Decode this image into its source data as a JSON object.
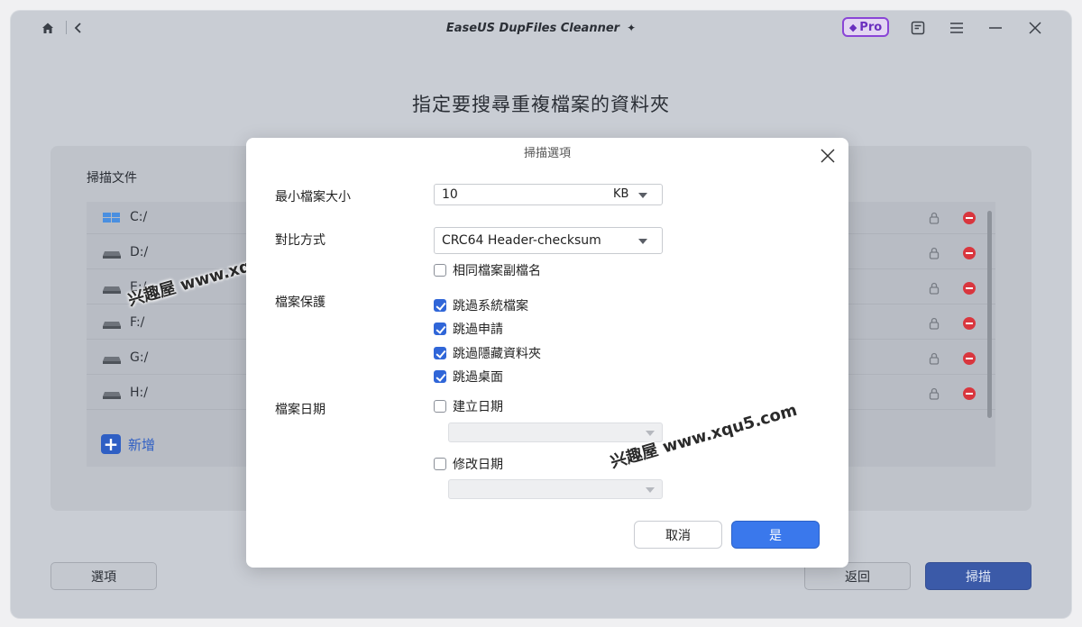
{
  "app": {
    "title": "EaseUS DupFiles Cleanner",
    "pro_label": "Pro"
  },
  "page": {
    "title": "指定要搜尋重複檔案的資料夾"
  },
  "scan_panel": {
    "label": "掃描文件",
    "drives": [
      {
        "label": "C:/"
      },
      {
        "label": "D:/"
      },
      {
        "label": "E:/"
      },
      {
        "label": "F:/"
      },
      {
        "label": "G:/"
      },
      {
        "label": "H:/"
      }
    ],
    "add_label": "新增"
  },
  "footer": {
    "options_label": "選項",
    "back_label": "返回",
    "scan_label": "掃描"
  },
  "watermark": {
    "text1": "兴趣屋 www.xqu5.com",
    "text2": "兴趣屋 www.xqu5.com"
  },
  "modal": {
    "title": "掃描選項",
    "min_size": {
      "label": "最小檔案大小",
      "value": "10",
      "unit": "KB"
    },
    "compare": {
      "label": "對比方式",
      "value": "CRC64 Header-checksum",
      "same_ext_label": "相同檔案副檔名",
      "same_ext_checked": false
    },
    "protection": {
      "label": "檔案保護",
      "options": [
        {
          "label": "跳過系統檔案",
          "checked": true
        },
        {
          "label": "跳過申請",
          "checked": true
        },
        {
          "label": "跳過隱藏資料夾",
          "checked": true
        },
        {
          "label": "跳過桌面",
          "checked": true
        }
      ]
    },
    "date": {
      "label": "檔案日期",
      "created_label": "建立日期",
      "created_checked": false,
      "modified_label": "修改日期",
      "modified_checked": false
    },
    "cancel_label": "取消",
    "confirm_label": "是"
  },
  "colors": {
    "accent": "#3a78ec",
    "danger": "#d9363e",
    "pro": "#8a45d6"
  }
}
